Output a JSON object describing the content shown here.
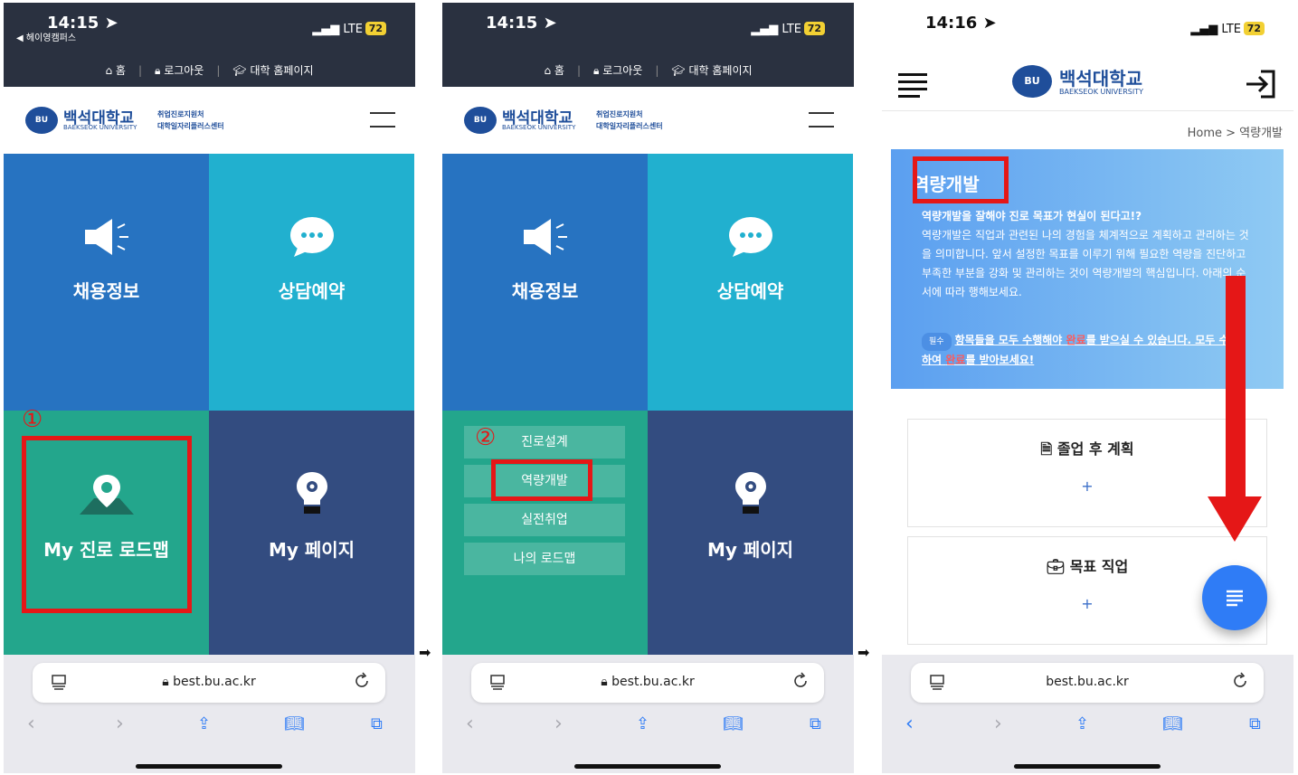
{
  "separator_arrow": "➡",
  "phone1": {
    "status": {
      "time": "14:15",
      "back_label": "◀ 헤이영캠퍼스",
      "network": "LTE",
      "battery": "72"
    },
    "topnav": {
      "home": "홈",
      "logout": "로그아웃",
      "univ": "대학 홈페이지"
    },
    "logo": {
      "mark": "BU",
      "name": "백석대학교",
      "english": "BAEKSEOK UNIVERSITY",
      "sub1": "취업진로지원처",
      "sub2": "대학일자리플러스센터"
    },
    "tiles": {
      "jobs": "채용정보",
      "consult": "상담예약",
      "roadmap": "My 진로 로드맵",
      "mypage": "My 페이지"
    },
    "step_marker": "①",
    "browser": {
      "url": "best.bu.ac.kr"
    }
  },
  "phone2": {
    "status": {
      "time": "14:15",
      "network": "LTE",
      "battery": "72"
    },
    "topnav": {
      "home": "홈",
      "logout": "로그아웃",
      "univ": "대학 홈페이지"
    },
    "logo": {
      "mark": "BU",
      "name": "백석대학교",
      "english": "BAEKSEOK UNIVERSITY",
      "sub1": "취업진로지원처",
      "sub2": "대학일자리플러스센터"
    },
    "tiles": {
      "jobs": "채용정보",
      "consult": "상담예약",
      "mypage": "My 페이지"
    },
    "submenu": [
      "진로설계",
      "역량개발",
      "실전취업",
      "나의 로드맵"
    ],
    "step_marker": "②",
    "browser": {
      "url": "best.bu.ac.kr"
    }
  },
  "phone3": {
    "status": {
      "time": "14:16",
      "network": "LTE",
      "battery": "72"
    },
    "logo": {
      "mark": "BU",
      "name": "백석대학교",
      "english": "BAEKSEOK UNIVERSITY"
    },
    "breadcrumb": "Home > 역량개발",
    "hero": {
      "title": "역량개발",
      "question": "역량개발을 잘해야 진로 목표가 현실이 된다고!?",
      "body": "역량개발은 직업과 관련된 나의 경험을 체계적으로 계획하고 관리하는 것을 의미합니다. 앞서 설정한 목표를 이루기 위해 필요한 역량을 진단하고 부족한 부분을 강화 및 관리하는 것이 역량개발의 핵심입니다. 아래의 순서에 따라 행해보세요.",
      "required_badge": "필수",
      "required_text_a": "항목들을 모두 수행해야 ",
      "required_done": "완료",
      "required_text_b": "를 받으실 수 있습니다. 모두 수행하여 ",
      "required_done2": "완료",
      "required_text_c": "를 받아보세요!"
    },
    "cards": [
      {
        "title": "졸업 후 계획",
        "plus": "+"
      },
      {
        "title": "목표 직업",
        "plus": "+"
      }
    ],
    "browser": {
      "url": "best.bu.ac.kr"
    }
  }
}
